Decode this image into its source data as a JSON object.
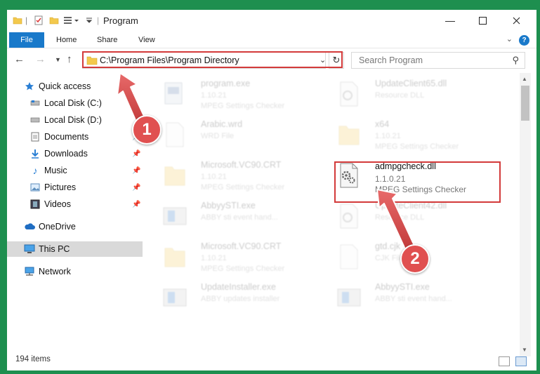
{
  "window": {
    "title": "Program"
  },
  "ribbon": {
    "tabs": [
      "File",
      "Home",
      "Share",
      "View"
    ]
  },
  "address": {
    "path": "C:\\Program Files\\Program Directory",
    "search_placeholder": "Search Program"
  },
  "sidebar": {
    "items": [
      {
        "label": "Quick access",
        "icon": "star-icon"
      },
      {
        "label": "Local Disk (C:)",
        "icon": "drive-icon"
      },
      {
        "label": "Local Disk (D:)",
        "icon": "drive-icon"
      },
      {
        "label": "Documents",
        "icon": "documents-icon"
      },
      {
        "label": "Downloads",
        "icon": "download-icon"
      },
      {
        "label": "Music",
        "icon": "music-icon"
      },
      {
        "label": "Pictures",
        "icon": "pictures-icon"
      },
      {
        "label": "Videos",
        "icon": "videos-icon"
      },
      {
        "label": "OneDrive",
        "icon": "cloud-icon"
      },
      {
        "label": "This PC",
        "icon": "computer-icon"
      },
      {
        "label": "Network",
        "icon": "network-icon"
      }
    ]
  },
  "files": [
    {
      "name": "program.exe",
      "l1": "1.10.21",
      "l2": "MPEG Settings Checker",
      "icon": "exe-icon"
    },
    {
      "name": "UpdateClient65.dll",
      "l1": "Resource DLL",
      "l2": "",
      "icon": "dll-icon"
    },
    {
      "name": "Arabic.wrd",
      "l1": "WRD File",
      "l2": "",
      "icon": "file-icon"
    },
    {
      "name": "x64",
      "l1": "1.10.21",
      "l2": "MPEG Settings Checker",
      "icon": "folder-icon"
    },
    {
      "name": "Microsoft.VC90.CRT",
      "l1": "1.10.21",
      "l2": "MPEG Settings Checker",
      "icon": "folder-icon"
    },
    {
      "name": "admpgcheck.dll",
      "l1": "1.1.0.21",
      "l2": "MPEG Settings Checker",
      "icon": "dll-icon"
    },
    {
      "name": "AbbyySTI.exe",
      "l1": "ABBY sti event hand...",
      "l2": "",
      "icon": "window-icon"
    },
    {
      "name": "UpdateClient42.dll",
      "l1": "Resource DLL",
      "l2": "",
      "icon": "dll-icon"
    },
    {
      "name": "Microsoft.VC90.CRT",
      "l1": "1.10.21",
      "l2": "MPEG Settings Checker",
      "icon": "folder-icon"
    },
    {
      "name": "gtd.cjk",
      "l1": "CJK File",
      "l2": "",
      "icon": "file-icon"
    },
    {
      "name": "UpdateInstaller.exe",
      "l1": "ABBY updates installer",
      "l2": "",
      "icon": "window-icon"
    },
    {
      "name": "AbbyySTI.exe",
      "l1": "ABBY sti event hand...",
      "l2": "",
      "icon": "window-icon"
    }
  ],
  "status": {
    "item_count": "194 items"
  },
  "annotations": {
    "badge1": "1",
    "badge2": "2"
  },
  "colors": {
    "accent": "#1979ca",
    "highlight": "#d33a3a",
    "background": "#1e8f4f"
  }
}
